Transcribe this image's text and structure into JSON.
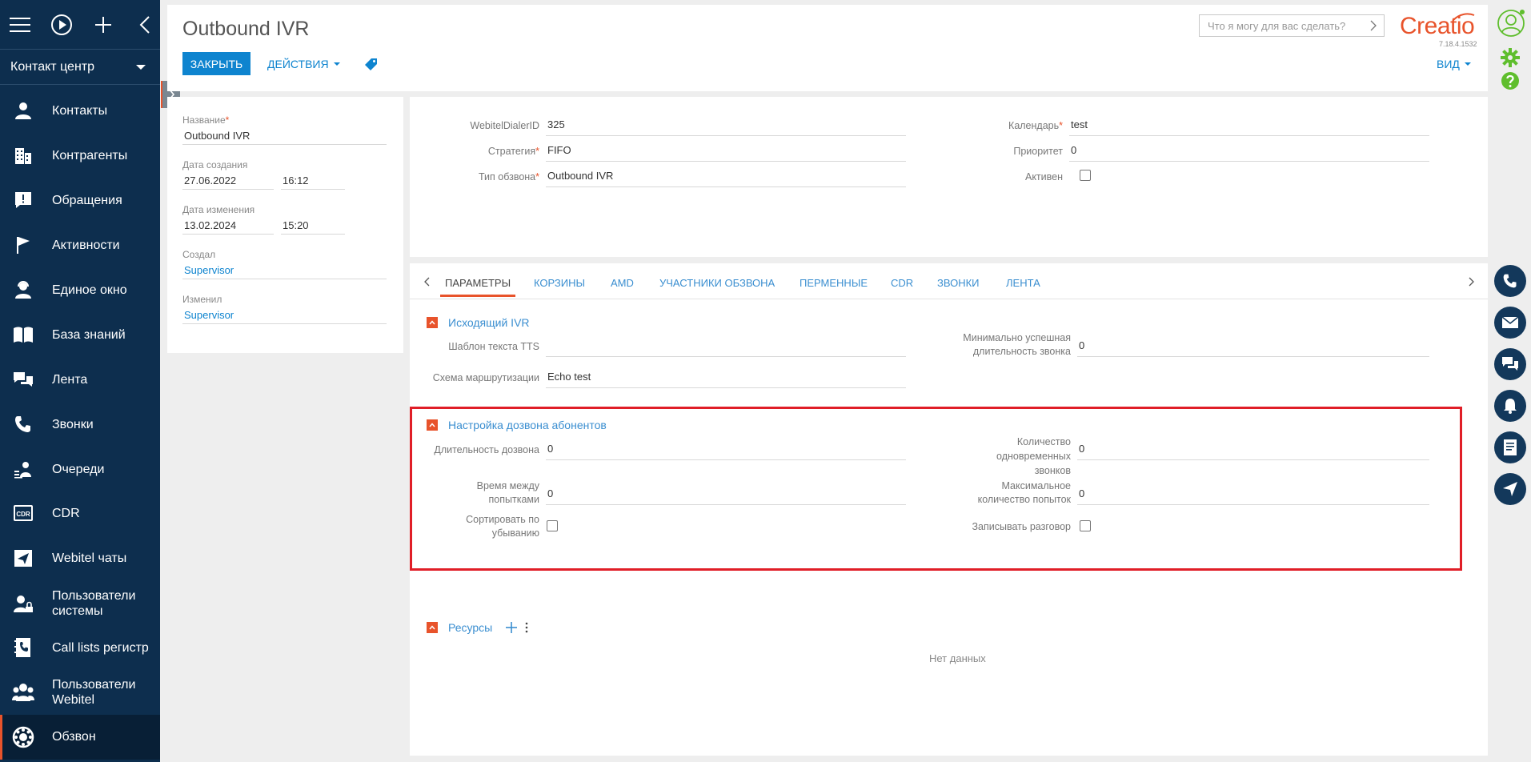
{
  "sidebar": {
    "workspace": "Контакт центр",
    "items": [
      {
        "label": "Контакты",
        "icon": "user-icon"
      },
      {
        "label": "Контрагенты",
        "icon": "building-icon"
      },
      {
        "label": "Обращения",
        "icon": "case-icon"
      },
      {
        "label": "Активности",
        "icon": "flag-icon"
      },
      {
        "label": "Единое окно",
        "icon": "agent-icon"
      },
      {
        "label": "База знаний",
        "icon": "book-icon"
      },
      {
        "label": "Лента",
        "icon": "feed-icon"
      },
      {
        "label": "Звонки",
        "icon": "phone-icon"
      },
      {
        "label": "Очереди",
        "icon": "queue-icon"
      },
      {
        "label": "CDR",
        "icon": "cdr-icon"
      },
      {
        "label": "Webitel чаты",
        "icon": "send-icon"
      },
      {
        "label": "Пользователи системы",
        "icon": "users-lock-icon"
      },
      {
        "label": "Call lists регистр",
        "icon": "calllist-icon"
      },
      {
        "label": "Пользователи Webitel",
        "icon": "users-icon"
      },
      {
        "label": "Обзвон",
        "icon": "dialer-icon"
      }
    ]
  },
  "header": {
    "title": "Outbound IVR",
    "close_label": "ЗАКРЫТЬ",
    "actions_label": "ДЕЙСТВИЯ",
    "view_label": "ВИД",
    "search_placeholder": "Что я могу для вас сделать?",
    "logo_text": "Creatio",
    "version": "7.18.4.1532"
  },
  "info": {
    "name_label": "Название",
    "name_value": "Outbound IVR",
    "created_label": "Дата создания",
    "created_date": "27.06.2022",
    "created_time": "16:12",
    "modified_label": "Дата изменения",
    "modified_date": "13.02.2024",
    "modified_time": "15:20",
    "createdby_label": "Создал",
    "createdby_value": "Supervisor",
    "modifiedby_label": "Изменил",
    "modifiedby_value": "Supervisor"
  },
  "main": {
    "dialer_id_label": "WebitelDialerID",
    "dialer_id_value": "325",
    "strategy_label": "Стратегия",
    "strategy_value": "FIFO",
    "type_label": "Тип обзвона",
    "type_value": "Outbound IVR",
    "calendar_label": "Календарь",
    "calendar_value": "test",
    "priority_label": "Приоритет",
    "priority_value": "0",
    "active_label": "Активен",
    "active_checked": false
  },
  "tabs": [
    "ПАРАМЕТРЫ",
    "КОРЗИНЫ",
    "AMD",
    "УЧАСТНИКИ ОБЗВОНА",
    "ПЕРМЕННЫЕ",
    "CDR",
    "ЗВОНКИ",
    "ЛЕНТА"
  ],
  "ivr_section": {
    "title": "Исходящий IVR",
    "tts_label": "Шаблон текста TTS",
    "tts_value": "",
    "routing_label": "Схема маршрутизации",
    "routing_value": "Echo test",
    "min_dur_label_1": "Минимально успешная",
    "min_dur_label_2": "длительность звонка",
    "min_dur_value": "0"
  },
  "dial_section": {
    "title": "Настройка дозвона абонентов",
    "duration_label": "Длительность дозвона",
    "duration_value": "0",
    "between_label_1": "Время между",
    "between_label_2": "попытками",
    "between_value": "0",
    "sort_label_1": "Сортировать по",
    "sort_label_2": "убыванию",
    "concurrent_label_1": "Количество",
    "concurrent_label_2": "одновременных",
    "concurrent_label_3": "звонков",
    "concurrent_value": "0",
    "max_attempts_label_1": "Максимальное",
    "max_attempts_label_2": "количество попыток",
    "max_attempts_value": "0",
    "record_label": "Записывать разговор"
  },
  "resources": {
    "title": "Ресурсы",
    "empty": "Нет данных"
  },
  "colors": {
    "sidebar_bg": "#0d2e4e",
    "accent": "#e8532b",
    "primary": "#0e84cf",
    "link": "#3a8ed0",
    "highlight_frame": "#e01e27",
    "settings_green": "#5fbe2d"
  }
}
